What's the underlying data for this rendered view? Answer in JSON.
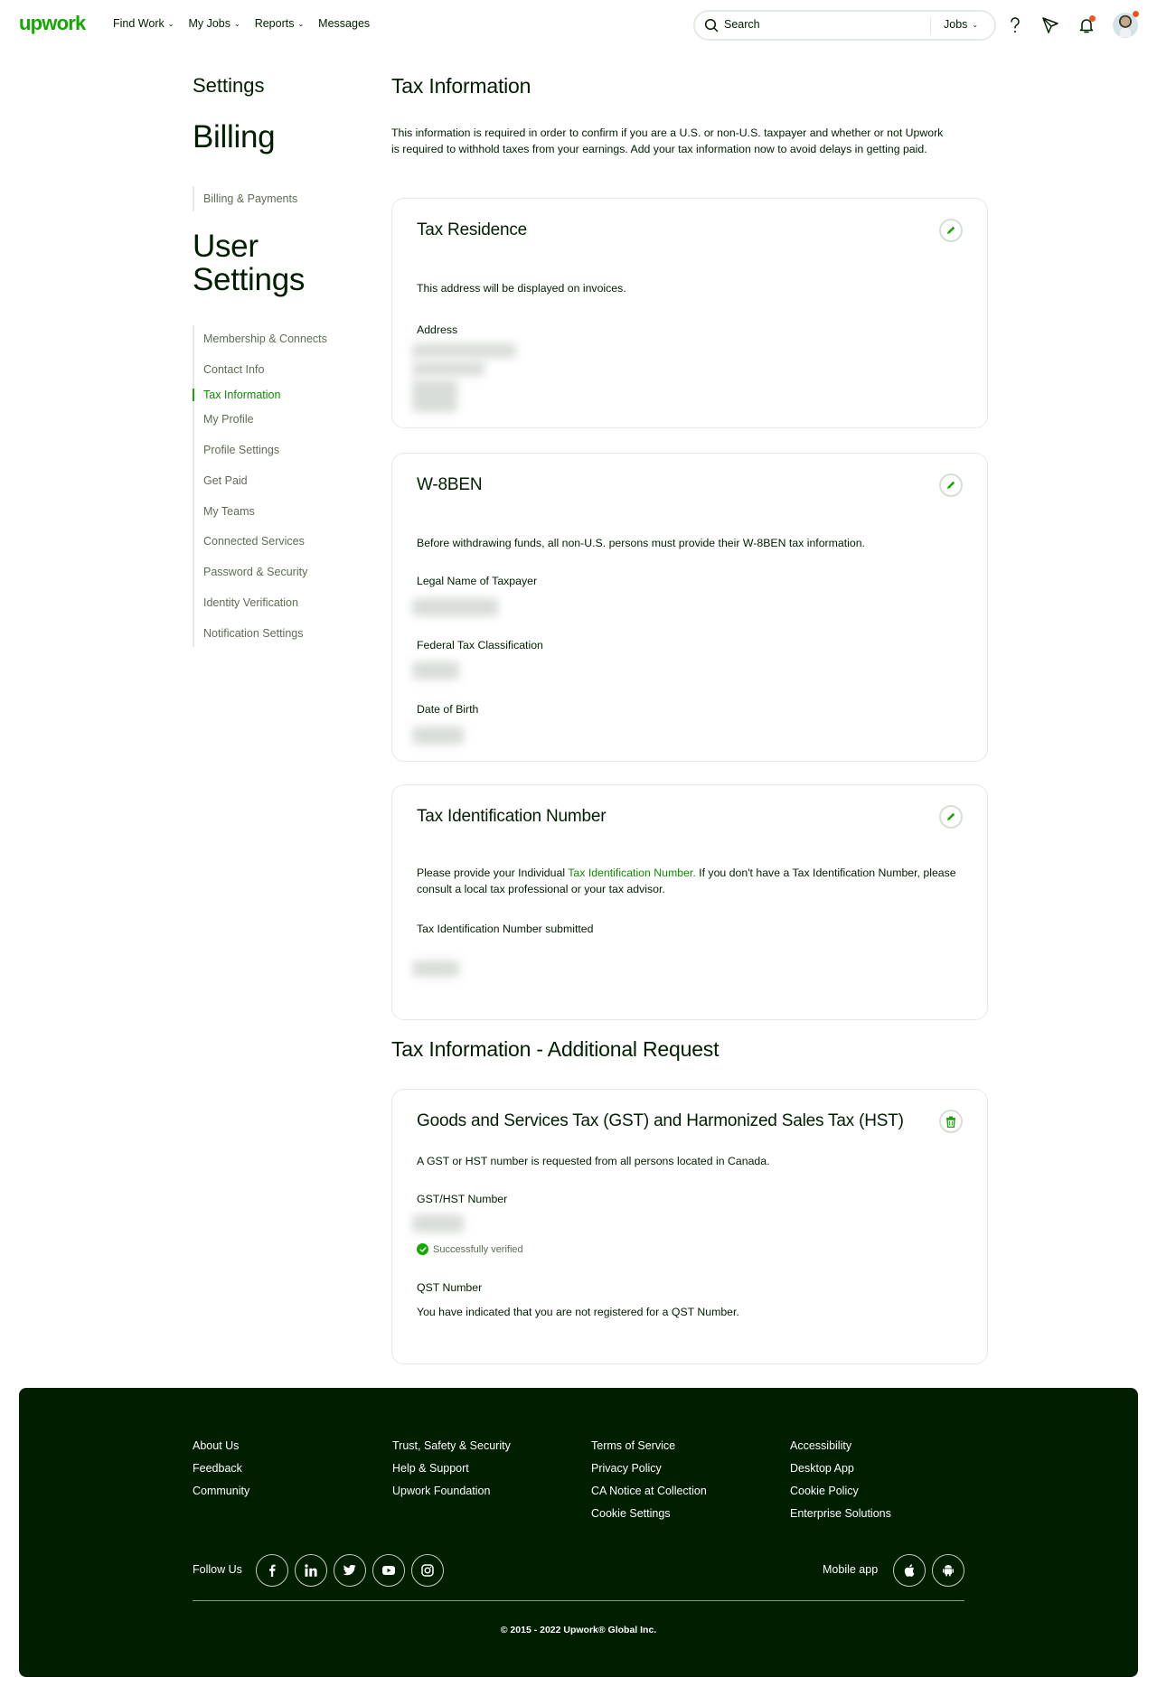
{
  "header": {
    "logo": "upwork",
    "nav": [
      {
        "label": "Find Work",
        "has_dropdown": true
      },
      {
        "label": "My Jobs",
        "has_dropdown": true
      },
      {
        "label": "Reports",
        "has_dropdown": true
      },
      {
        "label": "Messages",
        "has_dropdown": false
      }
    ],
    "search": {
      "placeholder": "Search",
      "scope": "Jobs"
    },
    "icons": [
      "help-icon",
      "send-proposal-icon",
      "notification-bell-icon",
      "avatar"
    ],
    "notification_dot_color": "#f6541e"
  },
  "sidebar": {
    "settings_label": "Settings",
    "billing_heading": "Billing",
    "billing_items": [
      {
        "label": "Billing & Payments",
        "active": false
      }
    ],
    "user_heading_line1": "User",
    "user_heading_line2": "Settings",
    "user_items": [
      {
        "label": "Membership & Connects",
        "active": false
      },
      {
        "label": "Contact Info",
        "active": false
      },
      {
        "label": "Tax Information",
        "active": true
      },
      {
        "label": "My Profile",
        "active": false
      },
      {
        "label": "Profile Settings",
        "active": false
      },
      {
        "label": "Get Paid",
        "active": false
      },
      {
        "label": "My Teams",
        "active": false
      },
      {
        "label": "Connected Services",
        "active": false
      },
      {
        "label": "Password & Security",
        "active": false
      },
      {
        "label": "Identity Verification",
        "active": false
      },
      {
        "label": "Notification Settings",
        "active": false
      }
    ]
  },
  "main": {
    "title": "Tax Information",
    "intro": "This information is required in order to confirm if you are a U.S. or non-U.S. taxpayer and whether or not Upwork is required to withhold taxes from your earnings. Add your tax information now to avoid delays in getting paid.",
    "tax_residence": {
      "title": "Tax Residence",
      "description": "This address will be displayed on invoices.",
      "address_label": "Address",
      "address_value": "[redacted]"
    },
    "w8ben": {
      "title": "W-8BEN",
      "description": "Before withdrawing funds, all non-U.S. persons must provide their W-8BEN tax information.",
      "fields": [
        {
          "label": "Legal Name of Taxpayer",
          "value": "[redacted]"
        },
        {
          "label": "Federal Tax Classification",
          "value": "[redacted]"
        },
        {
          "label": "Date of Birth",
          "value": "[redacted]"
        }
      ]
    },
    "tin": {
      "title": "Tax Identification Number",
      "description_pre": "Please provide your Individual ",
      "description_link": "Tax Identification Number.",
      "description_post": " If you don't have a Tax Identification Number, please consult a local tax professional or your tax advisor.",
      "submitted_label": "Tax Identification Number submitted",
      "value": "[redacted]"
    },
    "additional_title": "Tax Information - Additional Request",
    "gst": {
      "title": "Goods and Services Tax (GST) and Harmonized Sales Tax (HST)",
      "description": "A GST or HST number is requested from all persons located in Canada.",
      "gst_label": "GST/HST Number",
      "gst_value": "[redacted]",
      "verified_text": "Successfully verified",
      "qst_label": "QST Number",
      "qst_text": "You have indicated that you are not registered for a QST Number."
    }
  },
  "footer": {
    "columns": [
      [
        "About Us",
        "Feedback",
        "Community"
      ],
      [
        "Trust, Safety & Security",
        "Help & Support",
        "Upwork Foundation"
      ],
      [
        "Terms of Service",
        "Privacy Policy",
        "CA Notice at Collection",
        "Cookie Settings"
      ],
      [
        "Accessibility",
        "Desktop App",
        "Cookie Policy",
        "Enterprise Solutions"
      ]
    ],
    "follow_us": "Follow Us",
    "social": [
      "facebook-icon",
      "linkedin-icon",
      "twitter-icon",
      "youtube-icon",
      "instagram-icon"
    ],
    "mobile_app": "Mobile app",
    "apps": [
      "apple-icon",
      "android-icon"
    ],
    "copyright": "© 2015 - 2022 Upwork® Global Inc."
  },
  "colors": {
    "brand_green": "#14a800",
    "link_green": "#108a00",
    "text_dark": "#001e00",
    "footer_bg": "#001e00",
    "border": "#e4ebe4",
    "muted": "#5e6d55"
  }
}
